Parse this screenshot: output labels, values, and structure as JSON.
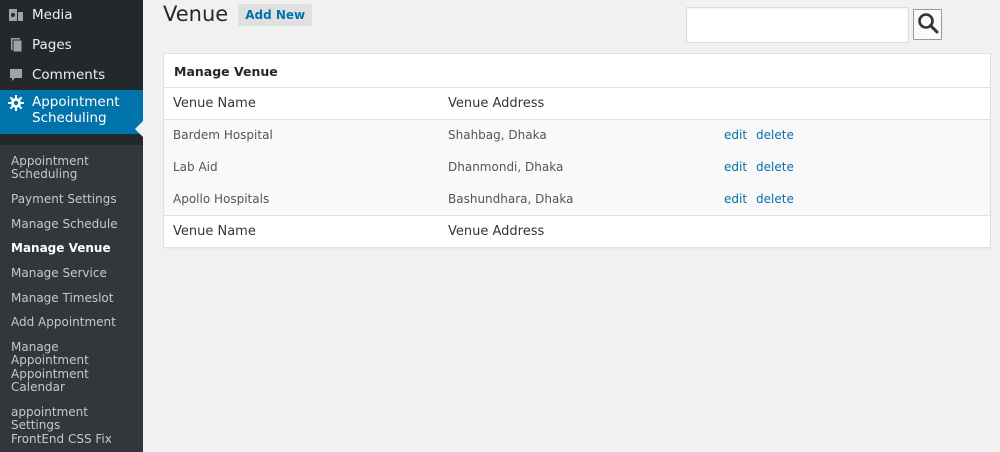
{
  "sidebar": {
    "menu": [
      {
        "label": "Media",
        "icon": "media-icon"
      },
      {
        "label": "Pages",
        "icon": "pages-icon"
      },
      {
        "label": "Comments",
        "icon": "comments-icon"
      }
    ],
    "current": {
      "label_line1": "Appointment",
      "label_line2": "Scheduling",
      "icon": "gear-icon"
    },
    "submenu": [
      {
        "label": "Appointment Scheduling"
      },
      {
        "label": "Payment Settings"
      },
      {
        "label": "Manage Schedule"
      },
      {
        "label": "Manage Venue"
      },
      {
        "label": "Manage Service"
      },
      {
        "label": "Manage Timeslot"
      },
      {
        "label": "Add Appointment"
      },
      {
        "label": "Manage Appointment"
      },
      {
        "label": "Appointment Calendar"
      },
      {
        "label": "appointment Settings"
      },
      {
        "label": "FrontEnd CSS Fix"
      }
    ]
  },
  "header": {
    "title": "Venue",
    "add_new_label": "Add New"
  },
  "search": {
    "value": "",
    "placeholder": ""
  },
  "venue_box": {
    "title": "Manage Venue",
    "columns": [
      "Venue Name",
      "Venue Address"
    ],
    "rows": [
      {
        "name": "Bardem Hospital",
        "address": "Shahbag, Dhaka",
        "edit": "edit",
        "delete": "delete"
      },
      {
        "name": "Lab Aid",
        "address": "Dhanmondi, Dhaka",
        "edit": "edit",
        "delete": "delete"
      },
      {
        "name": "Apollo Hospitals",
        "address": "Bashundhara, Dhaka",
        "edit": "edit",
        "delete": "delete"
      }
    ]
  },
  "colors": {
    "sidebar_bg": "#23282d",
    "submenu_bg": "#32373c",
    "accent": "#0073aa",
    "page_bg": "#f1f1f1"
  }
}
